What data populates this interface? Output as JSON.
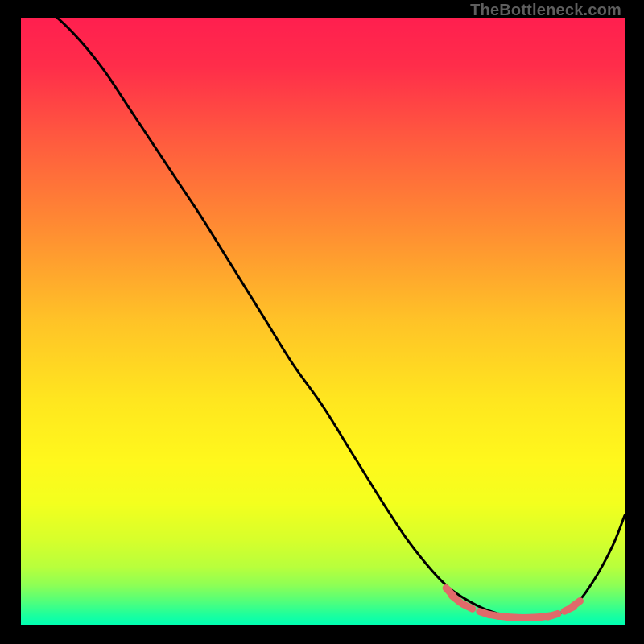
{
  "watermark": "TheBottleneck.com",
  "chart_data": {
    "type": "line",
    "title": "",
    "xlabel": "",
    "ylabel": "",
    "xlim": [
      0,
      100
    ],
    "ylim": [
      0,
      100
    ],
    "grid": false,
    "legend": false,
    "background_gradient": {
      "stops": [
        {
          "offset": 0.0,
          "color": "#ff1f4f"
        },
        {
          "offset": 0.08,
          "color": "#ff2d4a"
        },
        {
          "offset": 0.2,
          "color": "#ff5a3f"
        },
        {
          "offset": 0.35,
          "color": "#ff8d32"
        },
        {
          "offset": 0.5,
          "color": "#ffc327"
        },
        {
          "offset": 0.63,
          "color": "#ffe61f"
        },
        {
          "offset": 0.73,
          "color": "#fff81c"
        },
        {
          "offset": 0.8,
          "color": "#f3ff1e"
        },
        {
          "offset": 0.86,
          "color": "#d7ff2b"
        },
        {
          "offset": 0.905,
          "color": "#b8ff3c"
        },
        {
          "offset": 0.935,
          "color": "#8dff55"
        },
        {
          "offset": 0.96,
          "color": "#55ff78"
        },
        {
          "offset": 0.985,
          "color": "#1aff9f"
        },
        {
          "offset": 1.0,
          "color": "#00ffb1"
        }
      ]
    },
    "series": [
      {
        "name": "bottleneck-curve",
        "color": "#000000",
        "x": [
          0,
          3,
          6,
          10,
          14,
          18,
          22,
          26,
          30,
          35,
          40,
          45,
          50,
          55,
          60,
          64,
          68,
          71,
          74,
          77,
          80,
          83,
          86,
          89,
          92,
          95,
          98,
          100
        ],
        "y": [
          103,
          102,
          100,
          96,
          91,
          85,
          79,
          73,
          67,
          59,
          51,
          43,
          36,
          28,
          20,
          14,
          9,
          6,
          4,
          2.5,
          1.6,
          1.2,
          1.2,
          1.8,
          3.5,
          7.5,
          13,
          18
        ]
      }
    ],
    "markers": {
      "name": "sweet-spot",
      "color": "#e06a6a",
      "points": [
        {
          "x": 71.0,
          "y": 5.4
        },
        {
          "x": 72.1,
          "y": 4.2
        },
        {
          "x": 74.0,
          "y": 3.0
        },
        {
          "x": 76.8,
          "y": 1.9
        },
        {
          "x": 78.3,
          "y": 1.55
        },
        {
          "x": 79.8,
          "y": 1.35
        },
        {
          "x": 81.2,
          "y": 1.22
        },
        {
          "x": 82.6,
          "y": 1.15
        },
        {
          "x": 84.0,
          "y": 1.15
        },
        {
          "x": 85.4,
          "y": 1.22
        },
        {
          "x": 86.8,
          "y": 1.35
        },
        {
          "x": 88.1,
          "y": 1.55
        },
        {
          "x": 90.8,
          "y": 2.6
        },
        {
          "x": 91.9,
          "y": 3.4
        }
      ]
    }
  }
}
